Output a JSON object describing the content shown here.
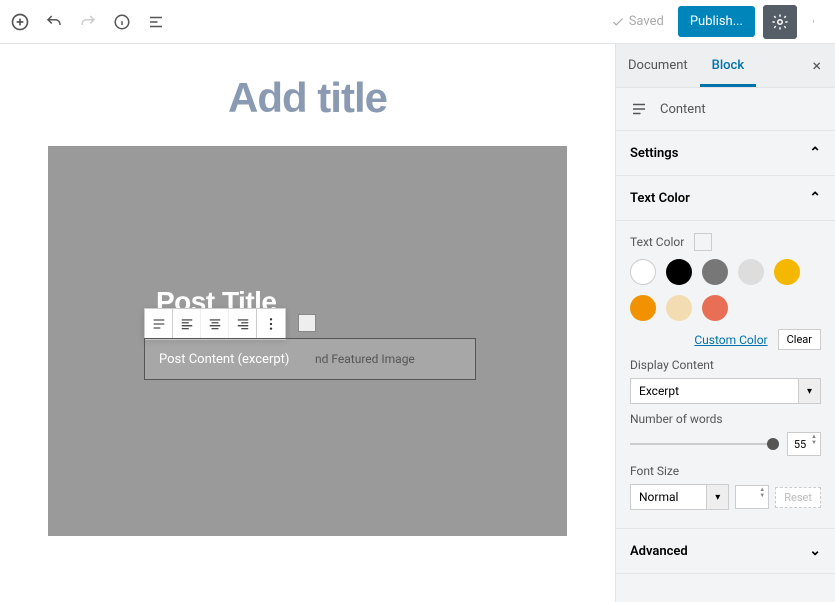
{
  "topbar": {
    "saved_label": "Saved",
    "publish_label": "Publish..."
  },
  "editor": {
    "title_placeholder": "Add title",
    "post_title": "Post Title",
    "content_placeholder": "Post Content (excerpt)",
    "featured_hint": "nd Featured Image"
  },
  "sidebar": {
    "tabs": {
      "document": "Document",
      "block": "Block"
    },
    "breadcrumb": "Content",
    "panels": {
      "settings": "Settings",
      "text_color": "Text Color",
      "advanced": "Advanced"
    },
    "text_color": {
      "label": "Text Color",
      "custom": "Custom Color",
      "clear": "Clear",
      "swatches": [
        "white",
        "black",
        "gray",
        "lgray",
        "yellow",
        "orange",
        "cream",
        "red"
      ]
    },
    "display_content": {
      "label": "Display Content",
      "value": "Excerpt"
    },
    "words": {
      "label": "Number of words",
      "value": "55"
    },
    "font": {
      "label": "Font Size",
      "value": "Normal",
      "reset": "Reset"
    }
  }
}
